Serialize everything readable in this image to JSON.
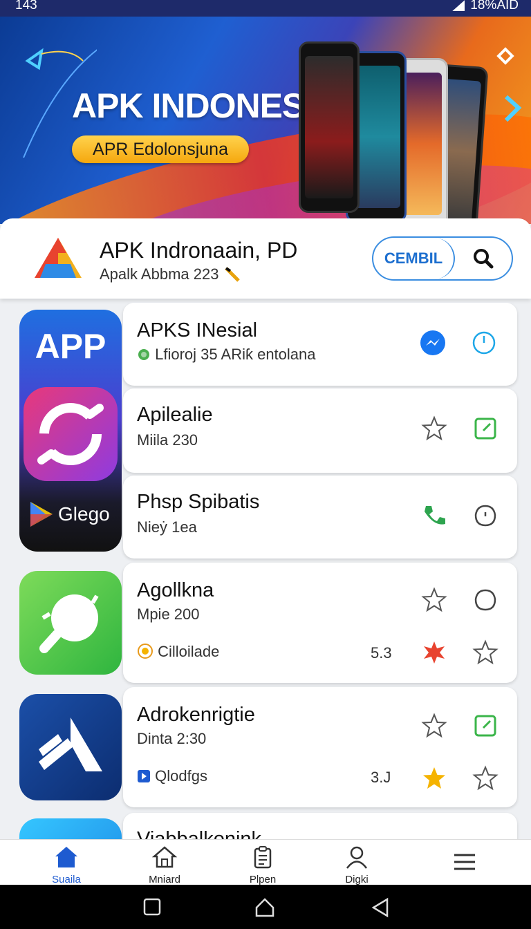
{
  "status": {
    "time": "143",
    "right_text": "18%AID"
  },
  "banner": {
    "title": "APK INDONESIA",
    "pill": "APR Edolonsjuna"
  },
  "header": {
    "title": "APK Indronaain, PD",
    "subtitle": "Apalk Abbma 223",
    "segment_label": "CEMBIL"
  },
  "group_tile": {
    "top_label": "APP",
    "bottom_label": "Glego"
  },
  "apps": [
    {
      "name": "APKS INesial",
      "sub": "Lfioroj 35 ARiƙ entolana"
    },
    {
      "name": "Apilealie",
      "sub": "Miila 230"
    },
    {
      "name": "Phsp Spibatis",
      "sub": "Nieẏ 1ea"
    },
    {
      "name": "Agollkna",
      "sub": "Mpie 200",
      "tag": "Cilloilade",
      "rating": "5.3"
    },
    {
      "name": "Adrokenrigtie",
      "sub": "Dinta 2:30",
      "tag": "Qlodfgs",
      "rating": "3.J"
    },
    {
      "name": "Viabbalkonink"
    }
  ],
  "nav": [
    {
      "label": "Suaila",
      "icon": "home-icon"
    },
    {
      "label": "Mniard",
      "icon": "house-outline-icon"
    },
    {
      "label": "Plpen",
      "icon": "clipboard-icon"
    },
    {
      "label": "Digki",
      "icon": "person-icon"
    },
    {
      "label": "",
      "icon": "menu-icon"
    }
  ],
  "colors": {
    "accent": "#1e5bd0",
    "green": "#3bb54a",
    "star": "#f5b301"
  }
}
